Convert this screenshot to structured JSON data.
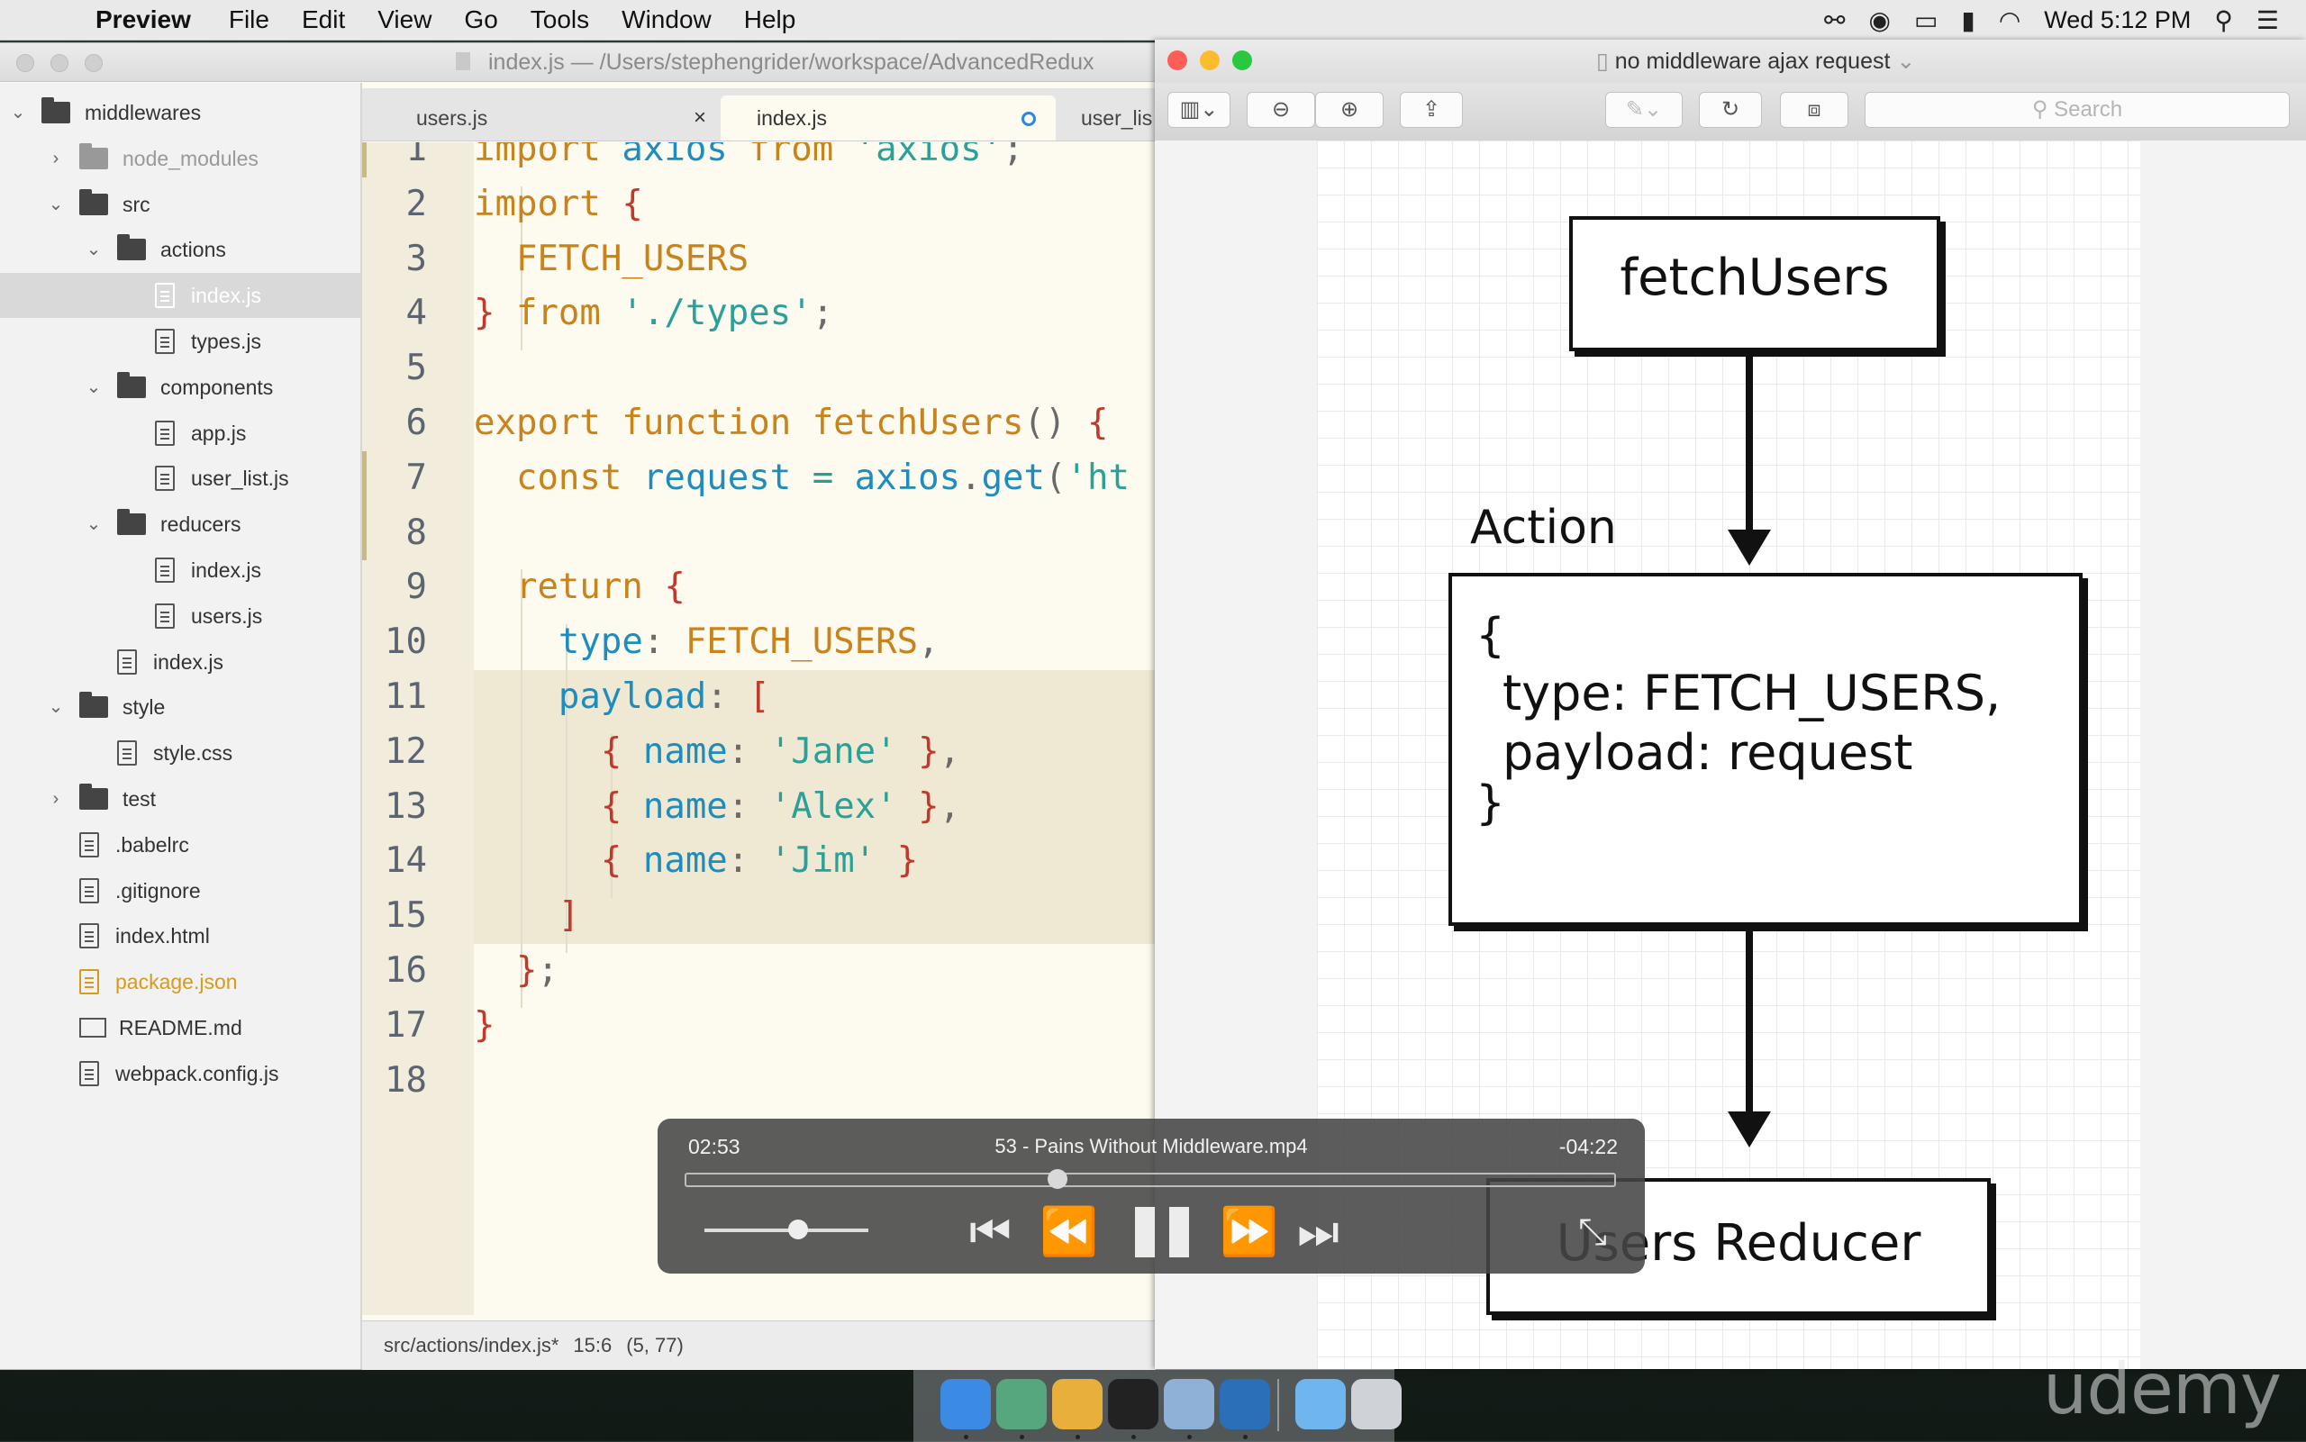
{
  "menubar": {
    "app": "Preview",
    "menus": [
      "File",
      "Edit",
      "View",
      "Go",
      "Tools",
      "Window",
      "Help"
    ],
    "clock": "Wed 5:12 PM"
  },
  "atom": {
    "title": "index.js — /Users/stephengrider/workspace/AdvancedRedux",
    "tree": [
      {
        "label": "middlewares",
        "kind": "folder",
        "depth": 0,
        "open": true
      },
      {
        "label": "node_modules",
        "kind": "folder",
        "depth": 1,
        "open": false,
        "muted": true
      },
      {
        "label": "src",
        "kind": "folder",
        "depth": 1,
        "open": true
      },
      {
        "label": "actions",
        "kind": "folder",
        "depth": 2,
        "open": true
      },
      {
        "label": "index.js",
        "kind": "file",
        "depth": 3,
        "selected": true
      },
      {
        "label": "types.js",
        "kind": "file",
        "depth": 3
      },
      {
        "label": "components",
        "kind": "folder",
        "depth": 2,
        "open": true
      },
      {
        "label": "app.js",
        "kind": "file",
        "depth": 3
      },
      {
        "label": "user_list.js",
        "kind": "file",
        "depth": 3
      },
      {
        "label": "reducers",
        "kind": "folder",
        "depth": 2,
        "open": true
      },
      {
        "label": "index.js",
        "kind": "file",
        "depth": 3
      },
      {
        "label": "users.js",
        "kind": "file",
        "depth": 3
      },
      {
        "label": "index.js",
        "kind": "file",
        "depth": 2
      },
      {
        "label": "style",
        "kind": "folder",
        "depth": 1,
        "open": true
      },
      {
        "label": "style.css",
        "kind": "file",
        "depth": 2
      },
      {
        "label": "test",
        "kind": "folder",
        "depth": 1,
        "open": false
      },
      {
        "label": ".babelrc",
        "kind": "file",
        "depth": 1
      },
      {
        "label": ".gitignore",
        "kind": "file",
        "depth": 1
      },
      {
        "label": "index.html",
        "kind": "file",
        "depth": 1
      },
      {
        "label": "package.json",
        "kind": "file",
        "depth": 1,
        "modified": true
      },
      {
        "label": "README.md",
        "kind": "book",
        "depth": 1
      },
      {
        "label": "webpack.config.js",
        "kind": "file",
        "depth": 1
      }
    ],
    "tabs": [
      {
        "label": "users.js",
        "state": "close"
      },
      {
        "label": "index.js",
        "state": "modified"
      },
      {
        "label": "user_lis",
        "state": ""
      }
    ],
    "code": [
      [
        [
          "kw",
          "import "
        ],
        [
          "id",
          "axios "
        ],
        [
          "kw",
          "from "
        ],
        [
          "st",
          "'axios'"
        ],
        [
          "pn",
          ";"
        ]
      ],
      [
        [
          "kw",
          "import "
        ],
        [
          "br",
          "{"
        ]
      ],
      [
        [
          "pn",
          "  "
        ],
        [
          "fn",
          "FETCH_USERS"
        ]
      ],
      [
        [
          "br",
          "} "
        ],
        [
          "kw",
          "from "
        ],
        [
          "st",
          "'./types'"
        ],
        [
          "pn",
          ";"
        ]
      ],
      [],
      [
        [
          "kw",
          "export function "
        ],
        [
          "fn",
          "fetchUsers"
        ],
        [
          "pn",
          "() "
        ],
        [
          "br",
          "{"
        ]
      ],
      [
        [
          "pn",
          "  "
        ],
        [
          "kw",
          "const "
        ],
        [
          "id",
          "request "
        ],
        [
          "op",
          "= "
        ],
        [
          "id",
          "axios"
        ],
        [
          "pn",
          "."
        ],
        [
          "id",
          "get"
        ],
        [
          "pn",
          "("
        ],
        [
          "st",
          "'ht"
        ]
      ],
      [],
      [
        [
          "pn",
          "  "
        ],
        [
          "kw",
          "return "
        ],
        [
          "br",
          "{"
        ]
      ],
      [
        [
          "pn",
          "    "
        ],
        [
          "id",
          "type"
        ],
        [
          "pn",
          ": "
        ],
        [
          "fn",
          "FETCH_USERS"
        ],
        [
          "pn",
          ","
        ]
      ],
      [
        [
          "pn",
          "    "
        ],
        [
          "id",
          "payload"
        ],
        [
          "pn",
          ": "
        ],
        [
          "br",
          "["
        ]
      ],
      [
        [
          "pn",
          "      "
        ],
        [
          "br",
          "{ "
        ],
        [
          "id",
          "name"
        ],
        [
          "pn",
          ": "
        ],
        [
          "st",
          "'Jane'"
        ],
        [
          "br",
          " }"
        ],
        [
          "pn",
          ","
        ]
      ],
      [
        [
          "pn",
          "      "
        ],
        [
          "br",
          "{ "
        ],
        [
          "id",
          "name"
        ],
        [
          "pn",
          ": "
        ],
        [
          "st",
          "'Alex'"
        ],
        [
          "br",
          " }"
        ],
        [
          "pn",
          ","
        ]
      ],
      [
        [
          "pn",
          "      "
        ],
        [
          "br",
          "{ "
        ],
        [
          "id",
          "name"
        ],
        [
          "pn",
          ": "
        ],
        [
          "st",
          "'Jim'"
        ],
        [
          "br",
          " }"
        ]
      ],
      [
        [
          "pn",
          "    "
        ],
        [
          "br",
          "]"
        ]
      ],
      [
        [
          "pn",
          "  "
        ],
        [
          "br",
          "}"
        ],
        [
          "pn",
          ";"
        ]
      ],
      [
        [
          "br",
          "}"
        ]
      ],
      []
    ],
    "status": {
      "path": "src/actions/index.js*",
      "cursor": "15:6",
      "selection": "(5, 77)"
    }
  },
  "preview": {
    "title": "no middleware ajax request",
    "search_placeholder": "Search",
    "diagram": {
      "box1": "fetchUsers",
      "label": "Action",
      "box2_lines": [
        "{",
        "type: FETCH_USERS,",
        "payload: request",
        "}"
      ],
      "box3": "Users Reducer"
    }
  },
  "video": {
    "elapsed": "02:53",
    "remaining": "-04:22",
    "title": "53 - Pains Without Middleware.mp4",
    "progress": 0.4,
    "volume": 0.57
  },
  "watermark": "udemy",
  "dock": [
    {
      "name": "finder",
      "color": "#3b8be5"
    },
    {
      "name": "atom",
      "color": "#56a77e"
    },
    {
      "name": "chrome",
      "color": "#e8b03a"
    },
    {
      "name": "terminal",
      "color": "#222222"
    },
    {
      "name": "preview",
      "color": "#8fb1d8"
    },
    {
      "name": "quicktime",
      "color": "#2a6fb8"
    },
    {
      "name": "folder",
      "color": "#6fb6ee"
    },
    {
      "name": "trash",
      "color": "#cfd3d8"
    }
  ]
}
